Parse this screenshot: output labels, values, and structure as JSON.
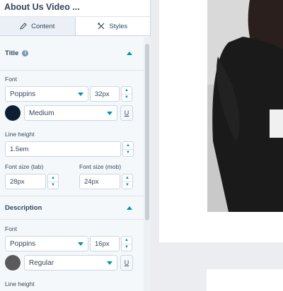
{
  "header": {
    "title": "About Us Video ..."
  },
  "tabs": [
    {
      "label": "Content",
      "icon": "pencil-icon"
    },
    {
      "label": "Styles",
      "icon": "brush-icon"
    }
  ],
  "title_section": {
    "heading": "Title",
    "font_label": "Font",
    "font_family": "Poppins",
    "font_size": "32px",
    "color": "#0e1e32",
    "weight": "Medium",
    "underline_label": "U",
    "line_height_label": "Line height",
    "line_height": "1.5em",
    "size_tab_label": "Font size (tab)",
    "size_tab": "28px",
    "size_mob_label": "Font size (mob)",
    "size_mob": "24px"
  },
  "description_section": {
    "heading": "Description",
    "font_label": "Font",
    "font_family": "Poppins",
    "font_size": "16px",
    "color": "#5a5a5a",
    "weight": "Regular",
    "underline_label": "U",
    "line_height_label": "Line height"
  },
  "colors": {
    "accent": "#0091ae",
    "text": "#33475b"
  }
}
